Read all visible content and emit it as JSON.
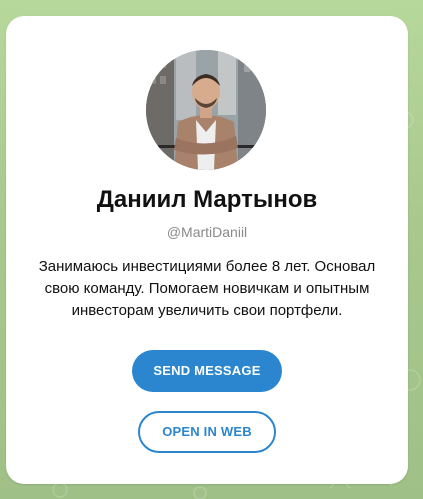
{
  "profile": {
    "name": "Даниил Мартынов",
    "username": "@MartiDaniil",
    "bio": "Занимаюсь инвестициями более 8 лет. Основал свою команду. Помогаем новичкам и опытным инвесторам увеличить свои портфели."
  },
  "actions": {
    "send_message": "SEND MESSAGE",
    "open_in_web": "OPEN IN WEB"
  },
  "colors": {
    "accent": "#2b86cf",
    "background": "#a9c98f",
    "card": "#ffffff"
  }
}
